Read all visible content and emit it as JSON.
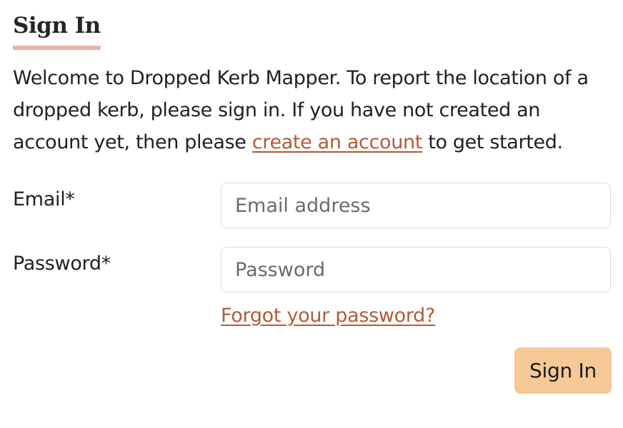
{
  "heading": {
    "title": "Sign In"
  },
  "intro": {
    "text_before_link": "Welcome to Dropped Kerb Mapper. To report the location of a dropped kerb, please sign in. If you have not created an account yet, then please ",
    "link_label": "create an account",
    "text_after_link": " to get started."
  },
  "form": {
    "email": {
      "label": "Email*",
      "placeholder": "Email address",
      "value": ""
    },
    "password": {
      "label": "Password*",
      "placeholder": "Password",
      "value": ""
    },
    "forgot_password_label": "Forgot your password?",
    "submit_label": "Sign In"
  },
  "colors": {
    "accent_link": "#b55a35",
    "heading_underline": "#ebb59f",
    "button_background": "#f5c895",
    "input_border": "#dddddd"
  }
}
